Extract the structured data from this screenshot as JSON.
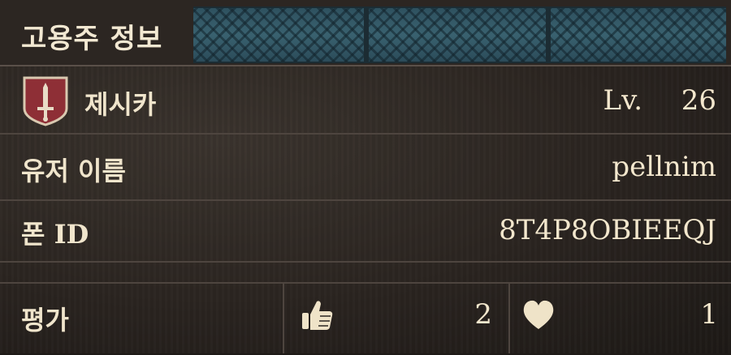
{
  "header": {
    "title": "고용주 정보"
  },
  "mercenary": {
    "name": "제시카",
    "level_label": "Lv.",
    "level": "26",
    "emblem_icon": "sword-shield-icon",
    "emblem_color": "#8e2f36"
  },
  "user": {
    "label": "유저 이름",
    "value": "pellnim"
  },
  "phone": {
    "label": "폰 ID",
    "value": "8T4P8OBIEEQJ"
  },
  "rating": {
    "label": "평가",
    "likes": "2",
    "hearts": "1",
    "like_icon": "thumbs-up-icon",
    "heart_icon": "heart-icon"
  },
  "colors": {
    "text": "#efe3c8",
    "band": "#3b6878",
    "background": "#2a2420"
  }
}
